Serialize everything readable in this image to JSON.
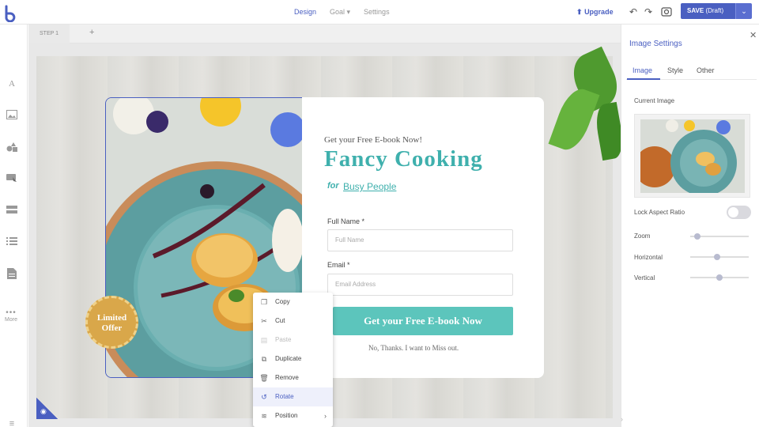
{
  "topbar": {
    "nav": [
      {
        "label": "Design",
        "active": true
      },
      {
        "label": "Goal ▾",
        "active": false
      },
      {
        "label": "Settings",
        "active": false
      }
    ],
    "upgrade_label": "Upgrade",
    "save_label": "SAVE",
    "save_state": "(Draft)"
  },
  "sidebar": {
    "icons": [
      "text-icon",
      "image-icon",
      "shapes-icon",
      "button-icon",
      "form-icon",
      "list-icon",
      "page-icon"
    ],
    "more_label": "More"
  },
  "stepbar": {
    "step_label": "STEP 1",
    "add_label": "+"
  },
  "popup": {
    "subtitle": "Get your Free E-book Now!",
    "title": "Fancy Cooking",
    "for_label": "for",
    "tagline": "Busy People",
    "fields": [
      {
        "label": "Full Name *",
        "placeholder": "Full Name"
      },
      {
        "label": "Email *",
        "placeholder": "Email Address"
      }
    ],
    "cta_label": "Get your Free E-book Now",
    "decline_label": "No, Thanks. I want to Miss out.",
    "badge_line1": "Limited",
    "badge_line2": "Offer"
  },
  "context_menu": {
    "items": [
      {
        "label": "Copy",
        "icon": "copy-icon",
        "state": "normal"
      },
      {
        "label": "Cut",
        "icon": "scissors-icon",
        "state": "normal"
      },
      {
        "label": "Paste",
        "icon": "paste-icon",
        "state": "disabled"
      },
      {
        "label": "Duplicate",
        "icon": "duplicate-icon",
        "state": "normal"
      },
      {
        "label": "Remove",
        "icon": "trash-icon",
        "state": "normal"
      },
      {
        "label": "Rotate",
        "icon": "rotate-icon",
        "state": "active"
      },
      {
        "label": "Position",
        "icon": "layers-icon",
        "state": "normal",
        "submenu": true
      }
    ]
  },
  "panel": {
    "title": "Image Settings",
    "tabs": [
      {
        "label": "Image",
        "active": true
      },
      {
        "label": "Style",
        "active": false
      },
      {
        "label": "Other",
        "active": false
      }
    ],
    "current_image_label": "Current Image",
    "lock_label": "Lock Aspect Ratio",
    "lock_on": false,
    "sliders": [
      {
        "label": "Zoom",
        "value": 0.08
      },
      {
        "label": "Horizontal",
        "value": 0.45
      },
      {
        "label": "Vertical",
        "value": 0.5
      }
    ]
  },
  "colors": {
    "accent": "#4a5fc1",
    "teal": "#3fb0ad",
    "cta": "#5cc5bc",
    "badge": "#d9a74a"
  }
}
